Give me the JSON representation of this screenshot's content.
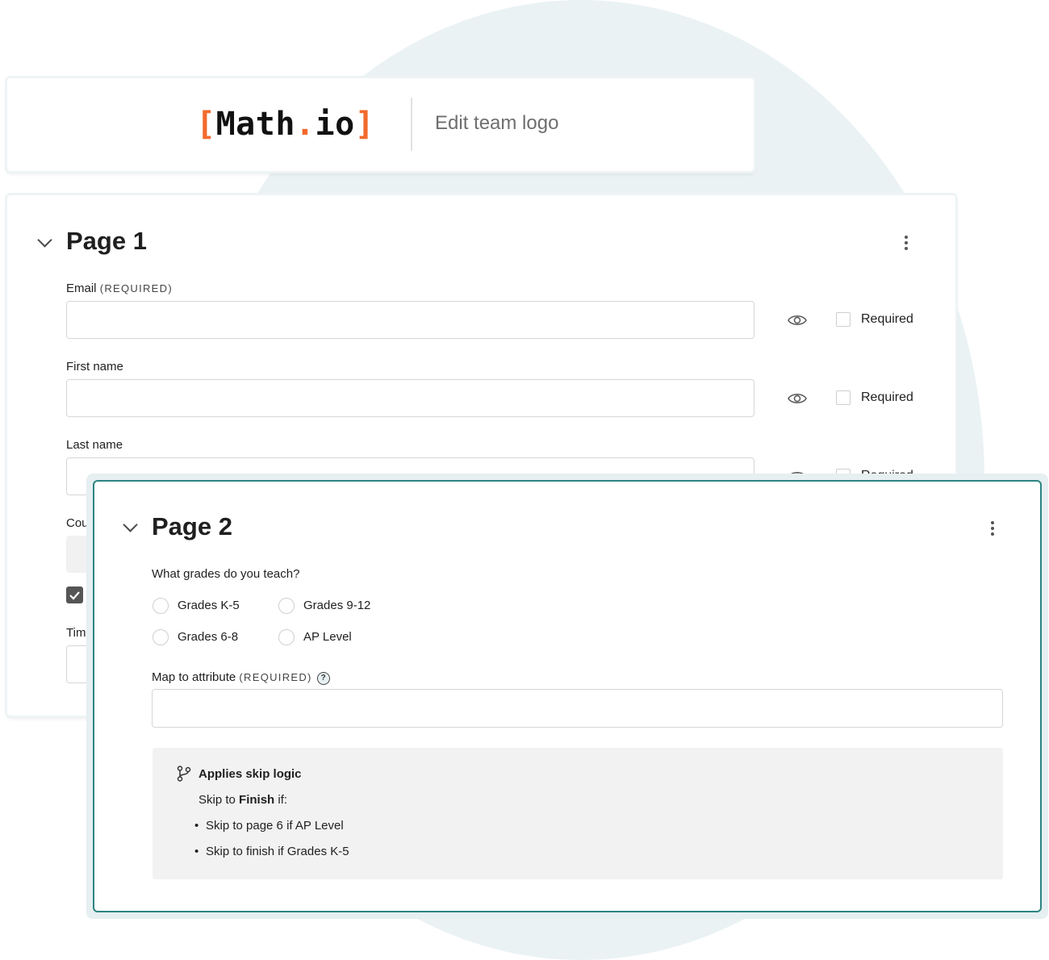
{
  "logo": {
    "bracket_open": "[",
    "name_part1": "Math",
    "dot": ".",
    "name_part2": "io",
    "bracket_close": "]",
    "edit_label": "Edit team logo"
  },
  "colors": {
    "accent": "#f26a2c",
    "page2_border": "#2b8580",
    "background_circle": "#eaf2f4"
  },
  "page1": {
    "title": "Page 1",
    "fields": [
      {
        "label": "Email",
        "required_tag": "(REQUIRED)",
        "value": "",
        "required_checkbox_label": "Required",
        "required_checked": false
      },
      {
        "label": "First name",
        "value": "",
        "required_checkbox_label": "Required",
        "required_checked": false
      },
      {
        "label": "Last name",
        "value": "",
        "required_checkbox_label": "Required",
        "required_checked": false
      }
    ],
    "partial_labels": {
      "country": "Cou",
      "time": "Time"
    },
    "checkbox_checked": true
  },
  "page2": {
    "title": "Page 2",
    "question": "What grades do you teach?",
    "options": [
      "Grades K-5",
      "Grades 9-12",
      "Grades 6-8",
      "AP Level"
    ],
    "map_label": "Map to attribute",
    "map_required_tag": "(REQUIRED)",
    "help_icon_glyph": "?",
    "map_value": "",
    "skip_logic": {
      "title": "Applies skip logic",
      "intro_prefix": "Skip to ",
      "intro_target": "Finish",
      "intro_suffix": " if:",
      "rules": [
        "Skip to page 6 if AP Level",
        "Skip to finish if Grades K-5"
      ]
    }
  }
}
